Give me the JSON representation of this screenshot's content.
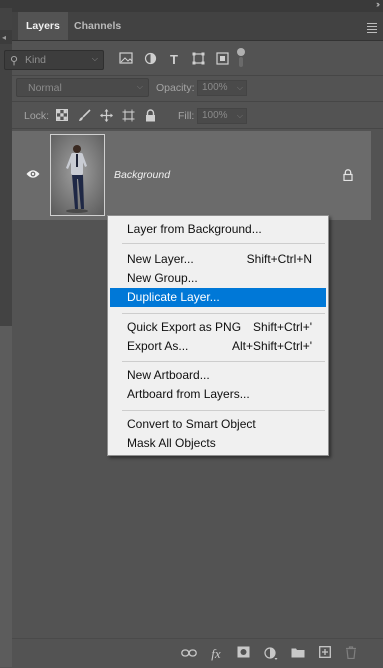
{
  "panel": {
    "tabs": [
      {
        "label": "Layers",
        "active": true
      },
      {
        "label": "Channels",
        "active": false
      }
    ],
    "collapse_icon": "double-chevron-right-icon",
    "menu_icon": "panel-menu-icon"
  },
  "filter": {
    "kind_label": "Kind",
    "icons": [
      "pixel-filter-icon",
      "adjustment-filter-icon",
      "type-filter-icon",
      "shape-filter-icon",
      "smartobject-filter-icon"
    ]
  },
  "blend": {
    "mode": "Normal",
    "opacity_label": "Opacity:",
    "opacity_value": "100%"
  },
  "lock": {
    "label": "Lock:",
    "fill_label": "Fill:",
    "fill_value": "100%",
    "icons": [
      "lock-transparent-icon",
      "lock-image-icon",
      "lock-position-icon",
      "lock-artboard-icon",
      "lock-all-icon"
    ]
  },
  "layers": [
    {
      "name": "Background",
      "visible": true,
      "locked": true
    }
  ],
  "context_menu": {
    "items": [
      {
        "label": "Layer from Background...",
        "shortcut": ""
      },
      {
        "label": "New Layer...",
        "shortcut": "Shift+Ctrl+N"
      },
      {
        "label": "New Group...",
        "shortcut": ""
      },
      {
        "label": "Duplicate Layer...",
        "shortcut": "",
        "selected": true
      },
      {
        "label": "Quick Export as PNG",
        "shortcut": "Shift+Ctrl+'"
      },
      {
        "label": "Export As...",
        "shortcut": "Alt+Shift+Ctrl+'"
      },
      {
        "label": "New Artboard...",
        "shortcut": ""
      },
      {
        "label": "Artboard from Layers...",
        "shortcut": ""
      },
      {
        "label": "Convert to Smart Object",
        "shortcut": ""
      },
      {
        "label": "Mask All Objects",
        "shortcut": ""
      }
    ]
  },
  "footer_icons": [
    "link-layers-icon",
    "fx-icon",
    "add-mask-icon",
    "adjustment-layer-icon",
    "new-group-icon",
    "new-layer-icon",
    "delete-icon"
  ],
  "colors": {
    "panel_bg": "#535353",
    "selected_layer_bg": "#6b6b6b",
    "menu_highlight": "#0078d7"
  }
}
